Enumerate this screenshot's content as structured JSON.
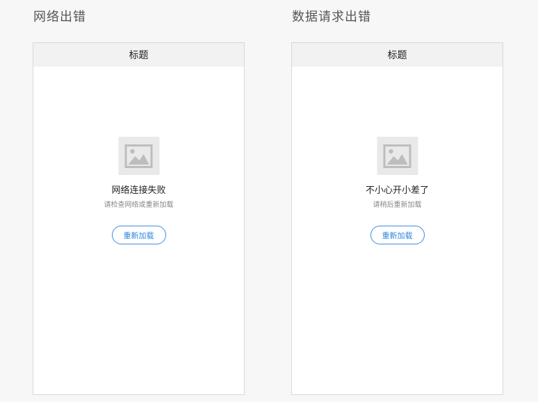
{
  "sections": [
    {
      "title": "网络出错",
      "navbar_title": "标题",
      "message": "网络连接失败",
      "hint": "请检查网络或重新加载",
      "button_label": "重新加载",
      "image_icon": "image-placeholder-icon"
    },
    {
      "title": "数据请求出错",
      "navbar_title": "标题",
      "message": "不小心开小差了",
      "hint": "请稍后重新加载",
      "button_label": "重新加载",
      "image_icon": "image-placeholder-icon"
    }
  ],
  "colors": {
    "page_background": "#f7f7f7",
    "navbar_background": "#f2f2f2",
    "button_border": "#3d8ce0",
    "button_text": "#2f86de",
    "placeholder_background": "#e9e9e9"
  }
}
